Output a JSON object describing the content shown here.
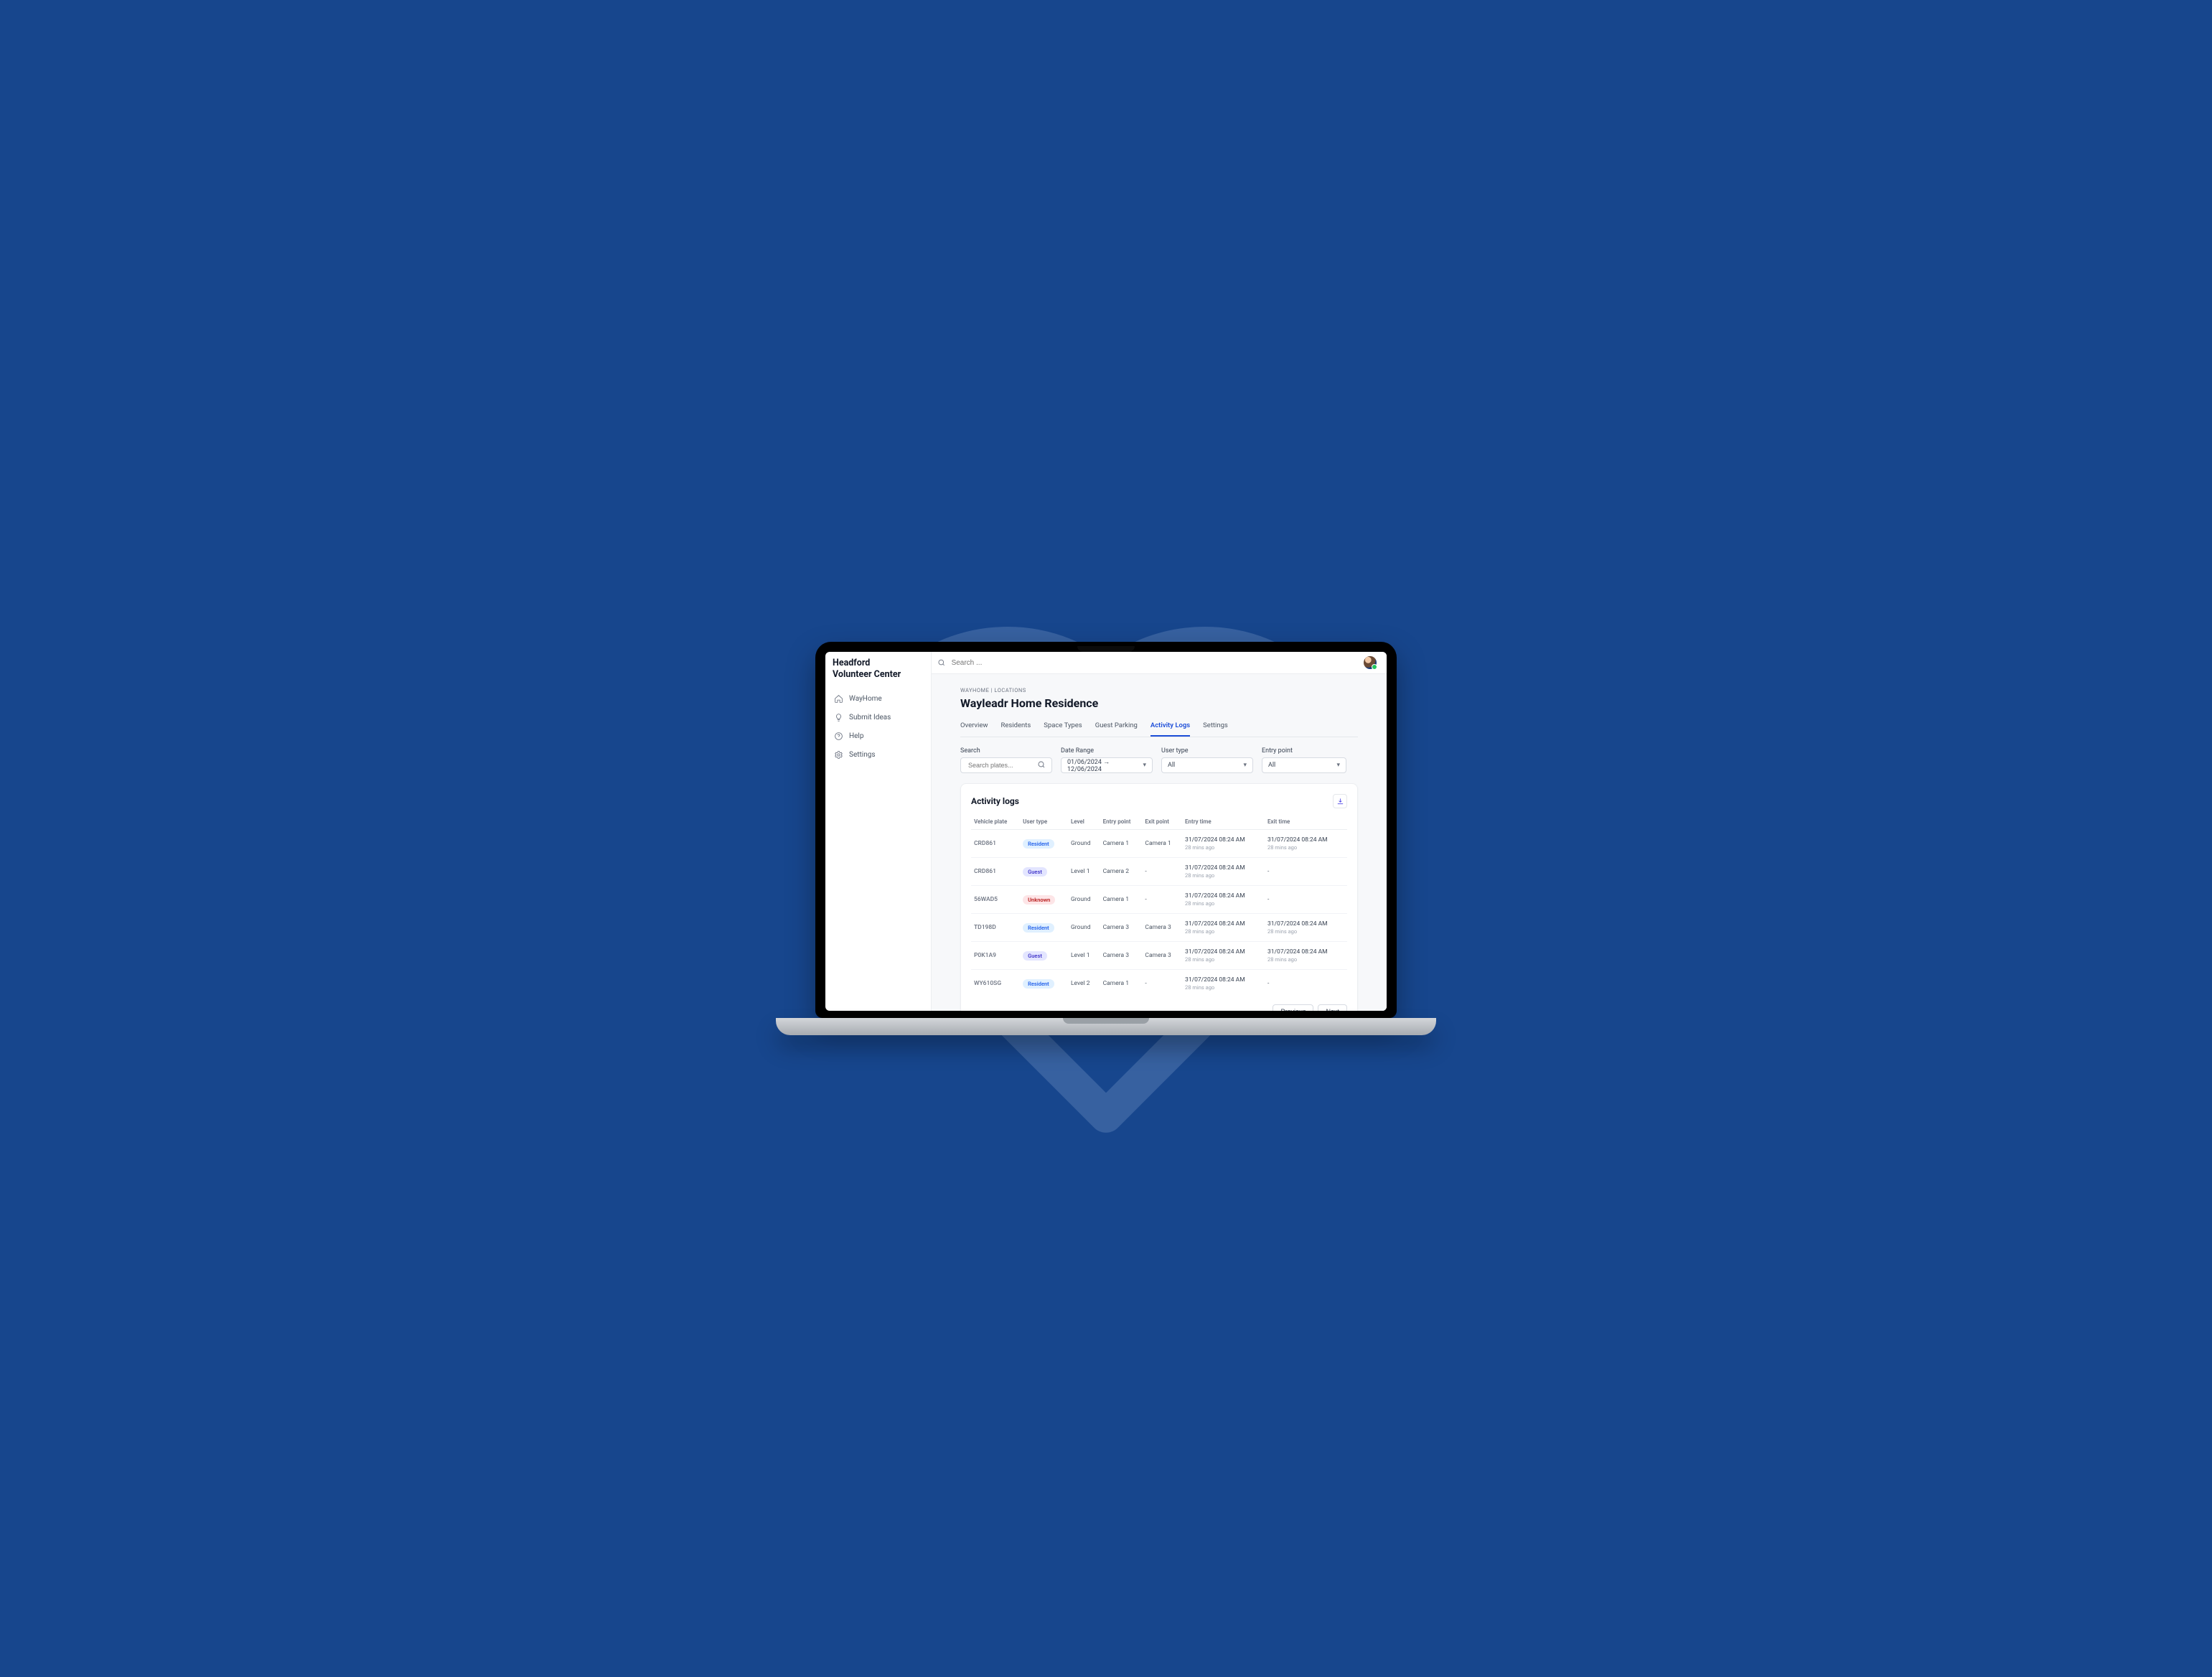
{
  "sidebar": {
    "brand_line1": "Headford",
    "brand_line2": "Volunteer Center",
    "items": [
      {
        "label": "WayHome",
        "icon": "home-icon"
      },
      {
        "label": "Submit Ideas",
        "icon": "lightbulb-icon"
      },
      {
        "label": "Help",
        "icon": "help-icon"
      },
      {
        "label": "Settings",
        "icon": "gear-icon"
      }
    ]
  },
  "topbar": {
    "search_placeholder": "Search ..."
  },
  "breadcrumb": "WAYHOME | LOCATIONS",
  "page_title": "Wayleadr Home Residence",
  "tabs": [
    {
      "label": "Overview"
    },
    {
      "label": "Residents"
    },
    {
      "label": "Space Types"
    },
    {
      "label": "Guest Parking"
    },
    {
      "label": "Activity Logs",
      "active": true
    },
    {
      "label": "Settings"
    }
  ],
  "filters": {
    "search": {
      "label": "Search",
      "placeholder": "Search plates..."
    },
    "date_range": {
      "label": "Date Range",
      "value": "01/06/2024 → 12/06/2024"
    },
    "user_type": {
      "label": "User type",
      "value": "All"
    },
    "entry_point": {
      "label": "Entry point",
      "value": "All"
    }
  },
  "card": {
    "title": "Activity logs",
    "columns": [
      "Vehicle plate",
      "User type",
      "Level",
      "Entry point",
      "Exit point",
      "Entry time",
      "Exit time"
    ],
    "rows": [
      {
        "plate": "CRD861",
        "user_type": "Resident",
        "level": "Ground",
        "entry": "Camera 1",
        "exit": "Camera 1",
        "entry_time": "31/07/2024 08:24 AM",
        "entry_rel": "28 mins ago",
        "exit_time": "31/07/2024 08:24 AM",
        "exit_rel": "28 mins ago"
      },
      {
        "plate": "CRD861",
        "user_type": "Guest",
        "level": "Level 1",
        "entry": "Camera 2",
        "exit": "-",
        "entry_time": "31/07/2024 08:24 AM",
        "entry_rel": "28 mins ago",
        "exit_time": "-",
        "exit_rel": ""
      },
      {
        "plate": "56WAD5",
        "user_type": "Unknown",
        "level": "Ground",
        "entry": "Camera 1",
        "exit": "-",
        "entry_time": "31/07/2024 08:24 AM",
        "entry_rel": "28 mins ago",
        "exit_time": "-",
        "exit_rel": ""
      },
      {
        "plate": "TD198D",
        "user_type": "Resident",
        "level": "Ground",
        "entry": "Camera 3",
        "exit": "Camera 3",
        "entry_time": "31/07/2024 08:24 AM",
        "entry_rel": "28 mins ago",
        "exit_time": "31/07/2024 08:24 AM",
        "exit_rel": "28 mins ago"
      },
      {
        "plate": "P0K1A9",
        "user_type": "Guest",
        "level": "Level 1",
        "entry": "Camera 3",
        "exit": "Camera 3",
        "entry_time": "31/07/2024 08:24 AM",
        "entry_rel": "28 mins ago",
        "exit_time": "31/07/2024 08:24 AM",
        "exit_rel": "28 mins ago"
      },
      {
        "plate": "WY610SG",
        "user_type": "Resident",
        "level": "Level 2",
        "entry": "Camera 1",
        "exit": "-",
        "entry_time": "31/07/2024 08:24 AM",
        "entry_rel": "28 mins ago",
        "exit_time": "-",
        "exit_rel": ""
      }
    ],
    "pagination": {
      "prev": "Previous",
      "next": "Next"
    }
  }
}
